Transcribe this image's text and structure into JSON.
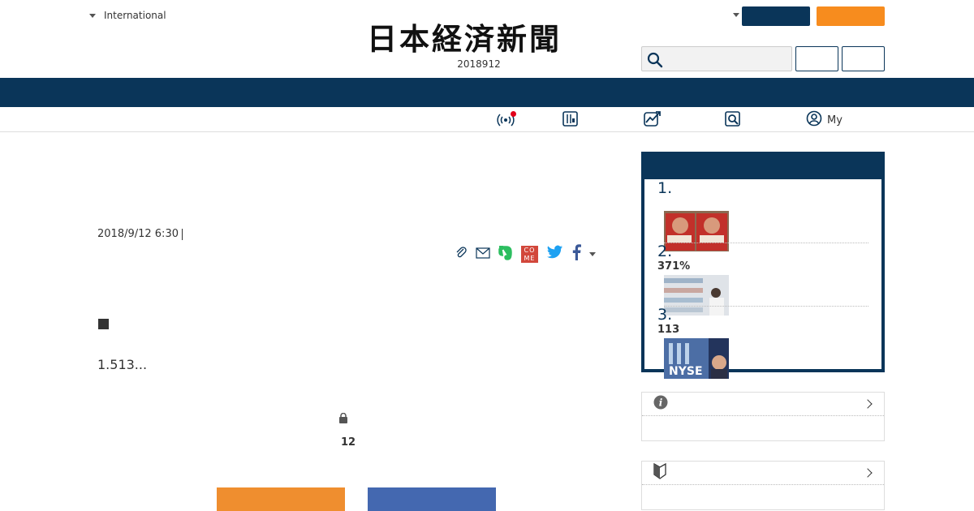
{
  "header": {
    "edition_label": "International",
    "logo_text": "日本経済新聞",
    "date": "2018912",
    "login_label": "",
    "signup_label": "",
    "search_placeholder": "",
    "btn1_label": "",
    "btn2_label": "",
    "colors": {
      "navy": "#0a3559",
      "orange": "#f78c1e"
    }
  },
  "subnav": {
    "items": [
      {
        "icon": "live-broadcast-icon",
        "label": ""
      },
      {
        "icon": "stock-board-icon",
        "label": ""
      },
      {
        "icon": "market-chart-icon",
        "label": ""
      },
      {
        "icon": "search-magnify-icon",
        "label": ""
      },
      {
        "icon": "user-circle-icon",
        "label": "My"
      }
    ]
  },
  "article": {
    "datetime": "2018/9/12 6:30",
    "share_icons": [
      "clip-icon",
      "mail-icon",
      "evernote-icon",
      "comeme-icon",
      "twitter-icon",
      "facebook-icon",
      "more-caret-icon"
    ],
    "comeme_text": "CO ME",
    "lead": "1.513...",
    "comment_count": "12",
    "cta_colors": {
      "orange": "#ef8e2f",
      "blue": "#4468b0"
    }
  },
  "ranking": {
    "title": "",
    "items": [
      {
        "rank": "1.",
        "sub": "",
        "thumb": "book-covers-fear"
      },
      {
        "rank": "2.",
        "sub": "371%",
        "thumb": "pharmacy-shelves"
      },
      {
        "rank": "3.",
        "sub": "113",
        "thumb": "nyse-trading"
      }
    ]
  },
  "side_boxes": [
    {
      "icon": "info-icon",
      "title": ""
    },
    {
      "icon": "beginner-mark-icon",
      "title": ""
    }
  ]
}
